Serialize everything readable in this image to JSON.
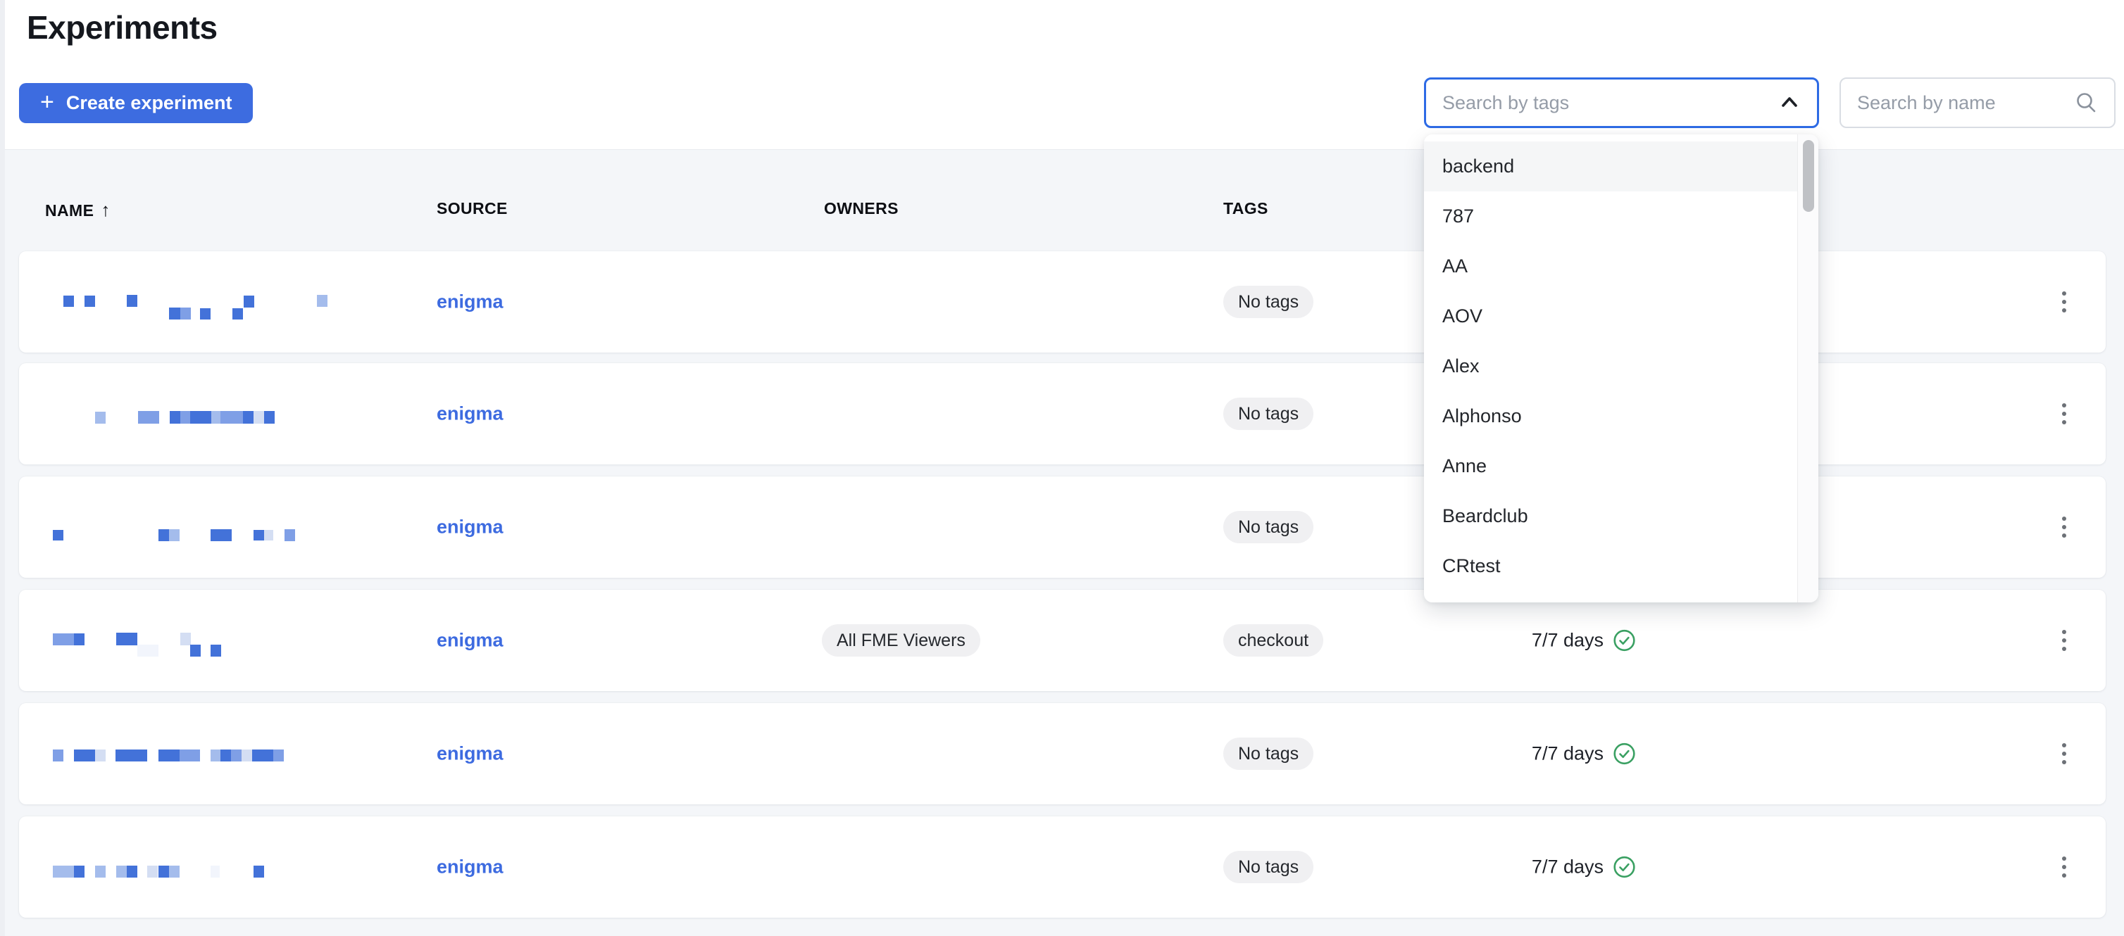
{
  "page": {
    "title": "Experiments"
  },
  "toolbar": {
    "plus_glyph": "+",
    "create_label": "Create experiment",
    "tag_search_placeholder": "Search by tags",
    "name_search_placeholder": "Search by name"
  },
  "tag_dropdown": {
    "highlighted": "backend",
    "items": [
      "backend",
      "787",
      "AA",
      "AOV",
      "Alex",
      "Alphonso",
      "Anne",
      "Beardclub",
      "CRtest"
    ]
  },
  "table": {
    "headers": {
      "name": "NAME",
      "source": "SOURCE",
      "owners": "OWNERS",
      "tags": "TAGS"
    },
    "sort": {
      "column": "NAME",
      "direction": "ascending",
      "arrow_glyph": "↑"
    },
    "rows": [
      {
        "source": "enigma",
        "owners": [],
        "tags": [
          "No tags"
        ],
        "duration": null,
        "name_blocks": [
          [
            63,
            63,
            15,
            16,
            "d"
          ],
          [
            93,
            63,
            15,
            16,
            "d"
          ],
          [
            153,
            62,
            15,
            17,
            "d"
          ],
          [
            213,
            80,
            16,
            17,
            "d"
          ],
          [
            229,
            80,
            15,
            17,
            "m"
          ],
          [
            257,
            81,
            15,
            16,
            "d"
          ],
          [
            303,
            81,
            15,
            16,
            "d"
          ],
          [
            319,
            63,
            15,
            17,
            "d"
          ],
          [
            423,
            62,
            15,
            17,
            "l"
          ]
        ]
      },
      {
        "source": "enigma",
        "owners": [],
        "tags": [
          "No tags"
        ],
        "duration": null,
        "name_blocks": [
          [
            108,
            69,
            15,
            17,
            "l"
          ],
          [
            169,
            68,
            15,
            18,
            "m"
          ],
          [
            184,
            68,
            15,
            18,
            "m"
          ],
          [
            214,
            68,
            15,
            18,
            "d"
          ],
          [
            229,
            68,
            14,
            18,
            "m"
          ],
          [
            243,
            68,
            15,
            18,
            "d"
          ],
          [
            258,
            68,
            15,
            18,
            "d"
          ],
          [
            273,
            68,
            13,
            18,
            "l"
          ],
          [
            286,
            68,
            15,
            18,
            "m"
          ],
          [
            301,
            68,
            17,
            18,
            "m"
          ],
          [
            318,
            68,
            15,
            18,
            "d"
          ],
          [
            333,
            68,
            15,
            18,
            "p"
          ],
          [
            348,
            68,
            15,
            18,
            "d"
          ]
        ]
      },
      {
        "source": "enigma",
        "owners": [],
        "tags": [
          "No tags"
        ],
        "duration": null,
        "name_blocks": [
          [
            48,
            76,
            15,
            15,
            "d"
          ],
          [
            198,
            75,
            15,
            17,
            "d"
          ],
          [
            213,
            75,
            15,
            17,
            "l"
          ],
          [
            272,
            75,
            15,
            17,
            "d"
          ],
          [
            287,
            75,
            15,
            17,
            "d"
          ],
          [
            333,
            76,
            15,
            15,
            "d"
          ],
          [
            348,
            76,
            13,
            15,
            "p"
          ],
          [
            377,
            75,
            15,
            17,
            "m"
          ]
        ]
      },
      {
        "source": "enigma",
        "owners": [
          "All FME Viewers"
        ],
        "tags": [
          "checkout"
        ],
        "duration": "7/7 days",
        "name_blocks": [
          [
            48,
            62,
            15,
            17,
            "m"
          ],
          [
            63,
            62,
            15,
            17,
            "m"
          ],
          [
            78,
            62,
            15,
            17,
            "d"
          ],
          [
            138,
            61,
            15,
            18,
            "d"
          ],
          [
            153,
            61,
            15,
            18,
            "d"
          ],
          [
            168,
            78,
            30,
            17,
            "f"
          ],
          [
            229,
            61,
            15,
            18,
            "p"
          ],
          [
            243,
            78,
            15,
            17,
            "d"
          ],
          [
            272,
            78,
            15,
            17,
            "d"
          ]
        ]
      },
      {
        "source": "enigma",
        "owners": [],
        "tags": [
          "No tags"
        ],
        "duration": "7/7 days",
        "name_blocks": [
          [
            48,
            66,
            15,
            17,
            "m"
          ],
          [
            78,
            66,
            15,
            17,
            "d"
          ],
          [
            93,
            66,
            15,
            17,
            "d"
          ],
          [
            108,
            66,
            15,
            17,
            "p"
          ],
          [
            137,
            66,
            15,
            17,
            "d"
          ],
          [
            152,
            66,
            15,
            17,
            "d"
          ],
          [
            167,
            66,
            15,
            17,
            "d"
          ],
          [
            198,
            66,
            15,
            17,
            "d"
          ],
          [
            213,
            66,
            15,
            17,
            "d"
          ],
          [
            228,
            66,
            15,
            17,
            "m"
          ],
          [
            243,
            66,
            14,
            17,
            "m"
          ],
          [
            272,
            66,
            14,
            17,
            "l"
          ],
          [
            286,
            66,
            15,
            17,
            "d"
          ],
          [
            301,
            66,
            15,
            17,
            "m"
          ],
          [
            316,
            66,
            15,
            17,
            "p"
          ],
          [
            331,
            66,
            15,
            17,
            "d"
          ],
          [
            346,
            66,
            15,
            17,
            "d"
          ],
          [
            361,
            66,
            15,
            17,
            "m"
          ]
        ]
      },
      {
        "source": "enigma",
        "owners": [],
        "tags": [
          "No tags"
        ],
        "duration": "7/7 days",
        "name_blocks": [
          [
            48,
            70,
            15,
            17,
            "l"
          ],
          [
            63,
            70,
            15,
            17,
            "l"
          ],
          [
            78,
            70,
            15,
            17,
            "d"
          ],
          [
            108,
            70,
            15,
            17,
            "l"
          ],
          [
            138,
            70,
            15,
            17,
            "l"
          ],
          [
            153,
            70,
            15,
            17,
            "d"
          ],
          [
            182,
            70,
            15,
            17,
            "p"
          ],
          [
            198,
            70,
            15,
            17,
            "d"
          ],
          [
            213,
            70,
            15,
            17,
            "l"
          ],
          [
            272,
            70,
            13,
            17,
            "f"
          ],
          [
            333,
            70,
            15,
            17,
            "d"
          ]
        ]
      }
    ]
  },
  "colors": {
    "accent_blue": "#3d6ce0",
    "focus_ring_blue": "#2e6be5",
    "link_blue": "#3d6be0",
    "check_green": "#3aa062",
    "chip_bg": "#f0f0f2",
    "redact_dark": "#4372d9",
    "redact_mid": "#7f9fe6",
    "redact_light": "#a4bcec",
    "redact_pale": "#d4def3",
    "redact_faint": "#f2f5fc"
  }
}
